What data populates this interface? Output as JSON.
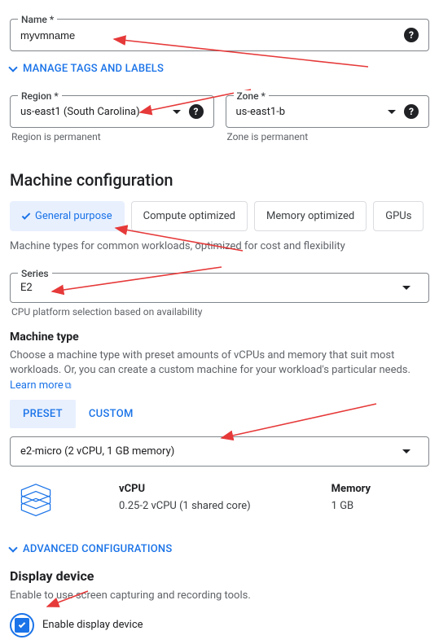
{
  "name": {
    "label": "Name *",
    "value": "myvmname"
  },
  "manage_tags_label": "MANAGE TAGS AND LABELS",
  "region": {
    "label": "Region *",
    "value": "us-east1 (South Carolina)",
    "hint": "Region is permanent"
  },
  "zone": {
    "label": "Zone *",
    "value": "us-east1-b",
    "hint": "Zone is permanent"
  },
  "machine_config": {
    "heading": "Machine configuration",
    "tabs": {
      "general": "General purpose",
      "compute": "Compute optimized",
      "memory": "Memory optimized",
      "gpus": "GPUs"
    },
    "tab_desc": "Machine types for common workloads, optimized for cost and flexibility",
    "series": {
      "label": "Series",
      "value": "E2",
      "hint": "CPU platform selection based on availability"
    },
    "machine_type": {
      "heading": "Machine type",
      "desc": "Choose a machine type with preset amounts of vCPUs and memory that suit most workloads. Or, you can create a custom machine for your workload's particular needs. ",
      "learn_more": "Learn more",
      "subtabs": {
        "preset": "PRESET",
        "custom": "CUSTOM"
      },
      "value": "e2-micro (2 vCPU, 1 GB memory)",
      "specs": {
        "vcpu_label": "vCPU",
        "vcpu_value": "0.25-2 vCPU (1 shared core)",
        "mem_label": "Memory",
        "mem_value": "1 GB"
      }
    },
    "advanced_label": "ADVANCED CONFIGURATIONS"
  },
  "display": {
    "heading": "Display device",
    "desc": "Enable to use screen capturing and recording tools.",
    "checkbox_label": "Enable display device"
  }
}
